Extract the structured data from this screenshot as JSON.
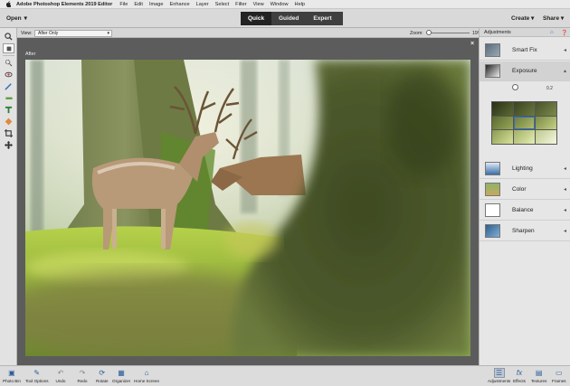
{
  "menubar": {
    "app_name": "Adobe Photoshop Elements 2019 Editor",
    "items": [
      "File",
      "Edit",
      "Image",
      "Enhance",
      "Layer",
      "Select",
      "Filter",
      "View",
      "Window",
      "Help"
    ]
  },
  "topbar": {
    "open_label": "Open",
    "modes": [
      "Quick",
      "Guided",
      "Expert"
    ],
    "active_mode": "Quick",
    "create_label": "Create",
    "share_label": "Share"
  },
  "options": {
    "view_label": "View:",
    "view_value": "After Only",
    "zoom_label": "Zoom:",
    "zoom_value": "19%",
    "zoom_level": 0.19
  },
  "canvas": {
    "after_label": "After",
    "close_glyph": "×"
  },
  "tools": [
    {
      "icon": "zoom-icon",
      "glyph": "⌕"
    },
    {
      "icon": "hand-icon",
      "glyph": "✋"
    },
    {
      "icon": "quick-selection-icon",
      "glyph": "◌"
    },
    {
      "icon": "red-eye-icon",
      "glyph": "◉"
    },
    {
      "icon": "whiten-teeth-icon",
      "glyph": "⟋"
    },
    {
      "icon": "straighten-icon",
      "glyph": "▬"
    },
    {
      "icon": "type-icon",
      "glyph": "T"
    },
    {
      "icon": "spot-healing-icon",
      "glyph": "◇"
    },
    {
      "icon": "crop-icon",
      "glyph": "⌗"
    },
    {
      "icon": "move-icon",
      "glyph": "✥"
    }
  ],
  "panel": {
    "title": "Adjustments",
    "items": [
      {
        "label": "Smart Fix",
        "icon": "smart-fix-icon",
        "open": false
      },
      {
        "label": "Exposure",
        "icon": "exposure-icon",
        "open": true
      },
      {
        "label": "Lighting",
        "icon": "lighting-icon",
        "open": false
      },
      {
        "label": "Color",
        "icon": "color-icon",
        "open": false
      },
      {
        "label": "Balance",
        "icon": "balance-icon",
        "open": false
      },
      {
        "label": "Sharpen",
        "icon": "sharpen-icon",
        "open": false
      }
    ],
    "exposure_value": "0.2",
    "exposure_level": 0.55
  },
  "bottombar": {
    "left": [
      {
        "label": "Photo Bin",
        "icon": "photo-bin-icon"
      },
      {
        "label": "Tool Options",
        "icon": "tool-options-icon"
      },
      {
        "label": "Undo",
        "icon": "undo-icon"
      },
      {
        "label": "Redo",
        "icon": "redo-icon"
      },
      {
        "label": "Rotate",
        "icon": "rotate-icon"
      },
      {
        "label": "Organizer",
        "icon": "organizer-icon"
      },
      {
        "label": "Home Screen",
        "icon": "home-screen-icon"
      }
    ],
    "right": [
      {
        "label": "Adjustments",
        "icon": "adjustments-icon"
      },
      {
        "label": "Effects",
        "icon": "effects-icon"
      },
      {
        "label": "Textures",
        "icon": "textures-icon"
      },
      {
        "label": "Frames",
        "icon": "frames-icon"
      }
    ]
  },
  "colors": {
    "accent": "#2f6fbf",
    "dark_mode_bg": "#222222"
  }
}
